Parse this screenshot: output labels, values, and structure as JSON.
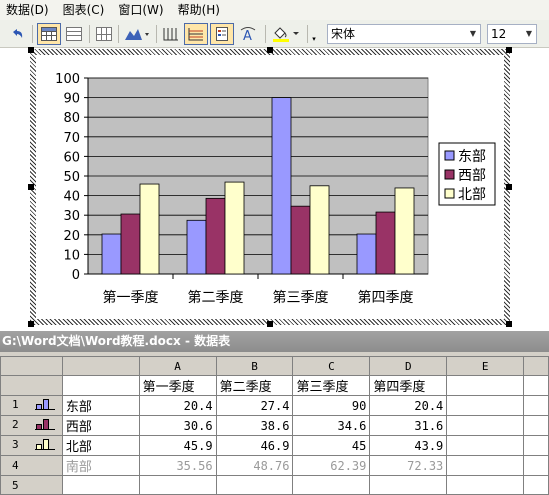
{
  "menu": [
    "数据(D)",
    "图表(C)",
    "窗口(W)",
    "帮助(H)"
  ],
  "toolbar": {
    "font_name": "宋体",
    "font_size": "12"
  },
  "chart_data": {
    "type": "bar",
    "categories": [
      "第一季度",
      "第二季度",
      "第三季度",
      "第四季度"
    ],
    "series": [
      {
        "name": "东部",
        "values": [
          20.4,
          27.4,
          90,
          20.4
        ],
        "color": "#9999ff"
      },
      {
        "name": "西部",
        "values": [
          30.6,
          38.6,
          34.6,
          31.6
        ],
        "color": "#993366"
      },
      {
        "name": "北部",
        "values": [
          45.9,
          46.9,
          45,
          43.9
        ],
        "color": "#ffffcc"
      }
    ],
    "ylim": [
      0,
      100
    ],
    "yticks": [
      0,
      10,
      20,
      30,
      40,
      50,
      60,
      70,
      80,
      90,
      100
    ],
    "plot_background": "#c0c0c0",
    "grid": true,
    "legend_position": "right"
  },
  "datasheet": {
    "title": "G:\\Word文档\\Word教程.docx - 数据表",
    "columns": [
      "",
      "A",
      "B",
      "C",
      "D",
      "E"
    ],
    "header_row": [
      "",
      "第一季度",
      "第二季度",
      "第三季度",
      "第四季度",
      ""
    ],
    "rows": [
      {
        "num": "1",
        "label": "东部",
        "values": [
          "20.4",
          "27.4",
          "90",
          "20.4"
        ],
        "color": "#9999ff"
      },
      {
        "num": "2",
        "label": "西部",
        "values": [
          "30.6",
          "38.6",
          "34.6",
          "31.6"
        ],
        "color": "#993366"
      },
      {
        "num": "3",
        "label": "北部",
        "values": [
          "45.9",
          "46.9",
          "45",
          "43.9"
        ],
        "color": "#ffffcc"
      },
      {
        "num": "4",
        "label": "南部",
        "values": [
          "35.56",
          "48.76",
          "62.39",
          "72.33"
        ],
        "color": ""
      },
      {
        "num": "5",
        "label": "",
        "values": [
          "",
          "",
          "",
          ""
        ],
        "color": ""
      }
    ]
  },
  "icons": [
    "undo-icon",
    "datasheet-icon",
    "by-row-icon",
    "by-column-icon",
    "data-table-icon",
    "chart-type-icon",
    "category-axis-gridlines-icon",
    "value-axis-gridlines-icon",
    "legend-icon",
    "text-rotate-icon",
    "fill-color-icon"
  ]
}
